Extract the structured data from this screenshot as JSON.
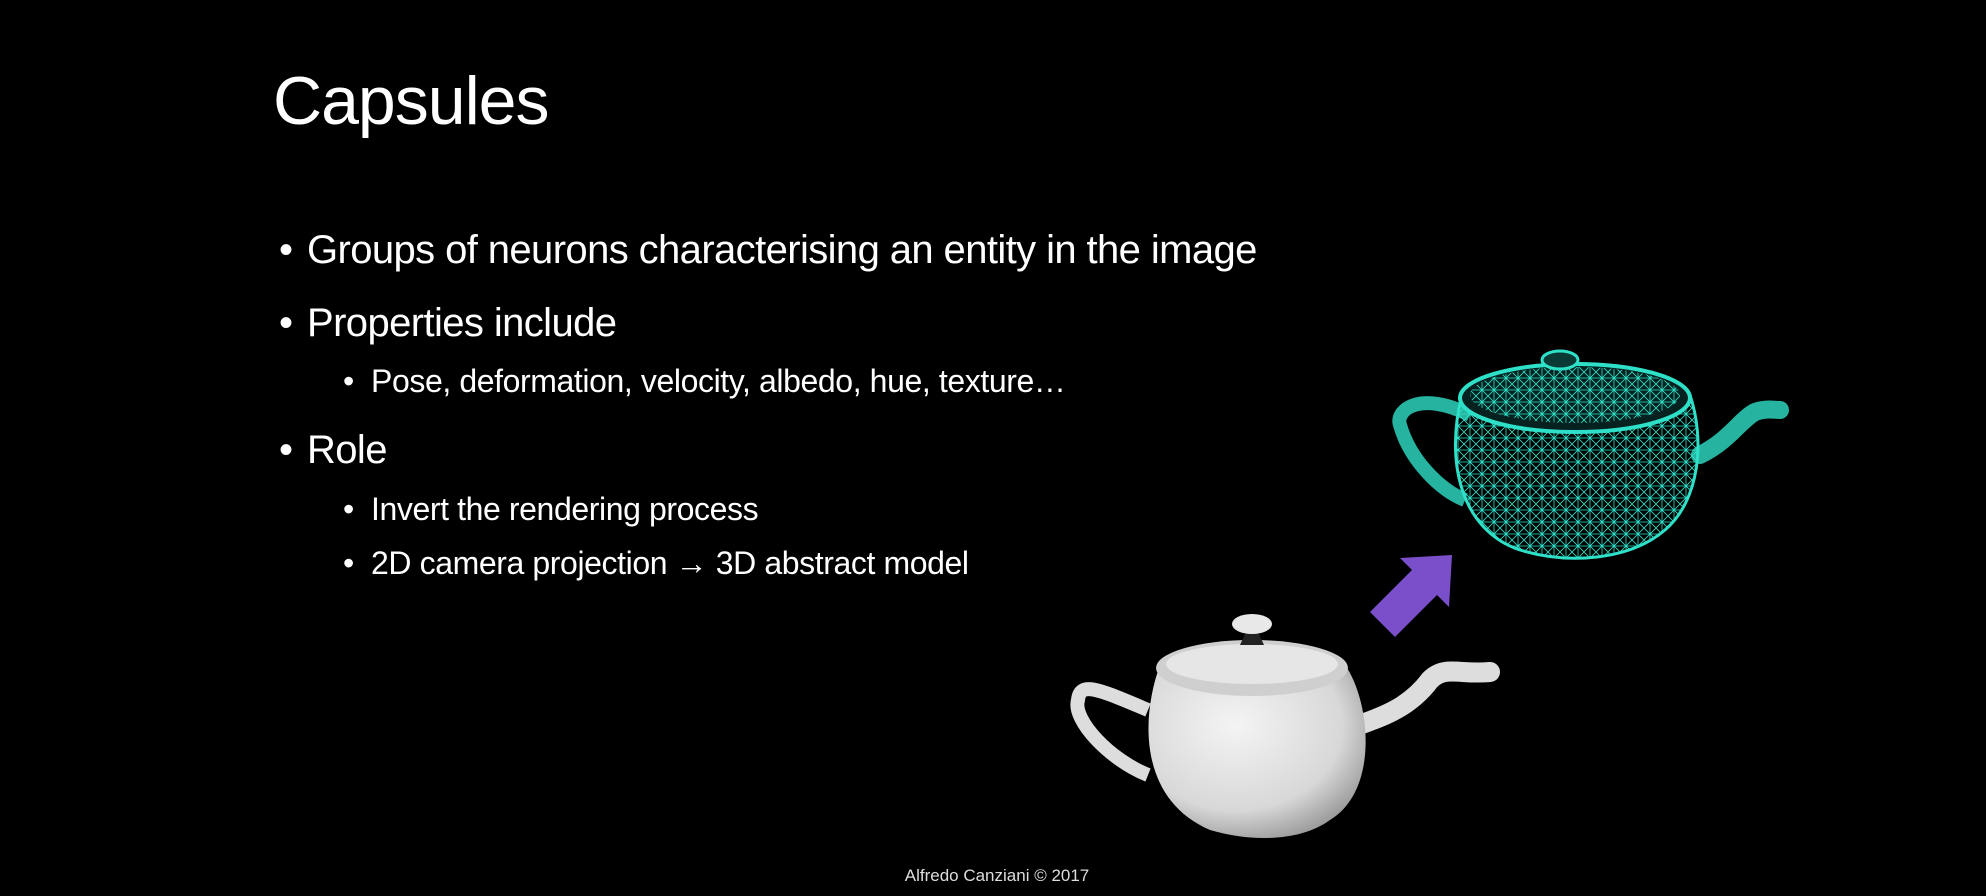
{
  "slide": {
    "title": "Capsules",
    "bullets": [
      {
        "level": 1,
        "text": "Groups of neurons characterising an entity in the image"
      },
      {
        "level": 1,
        "text": "Properties include"
      },
      {
        "level": 2,
        "text": "Pose, deformation, velocity, albedo, hue, texture…"
      },
      {
        "level": 1,
        "text": "Role"
      },
      {
        "level": 2,
        "text": "Invert the rendering process"
      },
      {
        "level": 2,
        "text": "2D camera projection → 3D abstract model"
      }
    ],
    "bullet_glyph": "•",
    "footer": "Alfredo Canziani © 2017"
  },
  "illustration": {
    "rendered_teapot_color": "#e6e6e6",
    "wireframe_teapot_color": "#2fe0c8",
    "arrow_color": "#7b4fc9"
  }
}
